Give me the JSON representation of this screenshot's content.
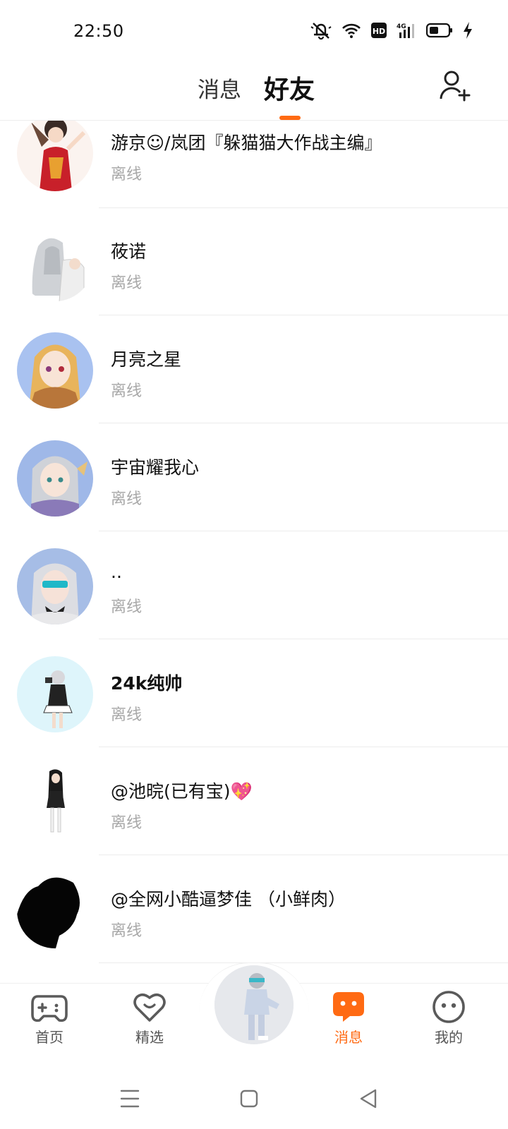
{
  "status_bar": {
    "time": "22:50",
    "icons": [
      "mute-bell-icon",
      "wifi-icon",
      "hd-icon",
      "4g-signal-icon",
      "battery-icon",
      "charging-icon"
    ]
  },
  "header": {
    "tabs": [
      {
        "label": "消息",
        "active": false
      },
      {
        "label": "好友",
        "active": true
      }
    ],
    "add_friend_icon": "add-person-icon",
    "accent_color": "#ff6a13"
  },
  "friends": [
    {
      "name": "游京☺/岚团『躲猫猫大作战主编』",
      "status": "离线"
    },
    {
      "name": "莜诺",
      "status": "离线"
    },
    {
      "name": "月亮之星",
      "status": "离线"
    },
    {
      "name": "宇宙耀我心",
      "status": "离线"
    },
    {
      "name": "..",
      "status": "离线"
    },
    {
      "name": "24k纯帅",
      "status": "离线"
    },
    {
      "name": "@池晥(已有宝)💖",
      "status": "离线"
    },
    {
      "name": "@全网小酷逼梦佳 （小鲜肉）",
      "status": "离线"
    }
  ],
  "bottom_nav": {
    "items": [
      {
        "label": "首页",
        "icon": "gamepad-icon",
        "active": false
      },
      {
        "label": "精选",
        "icon": "heart-chat-icon",
        "active": false
      },
      {
        "label": "消息",
        "icon": "message-bubble-icon",
        "active": true
      },
      {
        "label": "我的",
        "icon": "face-icon",
        "active": false
      }
    ]
  },
  "system_nav": {
    "icons": [
      "menu-icon",
      "home-square-icon",
      "back-triangle-icon"
    ]
  }
}
